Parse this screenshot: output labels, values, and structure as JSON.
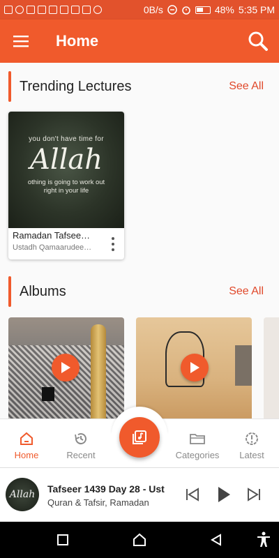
{
  "status_bar": {
    "network_speed": "0B/s",
    "battery": "48%",
    "time": "5:35 PM"
  },
  "app_bar": {
    "title": "Home"
  },
  "trending": {
    "title": "Trending Lectures",
    "see_all": "See All",
    "card": {
      "thumb_line1": "you don't have time for",
      "thumb_big": "Allah",
      "thumb_line2": "othing is going to work out",
      "thumb_line3": "right in your life",
      "title": "Ramadan Tafsee…",
      "speaker": "Ustadh Qamaarudee…"
    }
  },
  "albums": {
    "title": "Albums",
    "see_all": "See All"
  },
  "bottom_nav": {
    "items": [
      {
        "label": "Home",
        "icon": "home-icon",
        "active": true
      },
      {
        "label": "Recent",
        "icon": "history-icon",
        "active": false
      },
      {
        "label": "Categories",
        "icon": "folder-icon",
        "active": false
      },
      {
        "label": "Latest",
        "icon": "alert-icon",
        "active": false
      }
    ],
    "fab_icon": "music-library-icon"
  },
  "player": {
    "art_text": "Allah",
    "title": "Tafseer 1439 Day 28 - Ust",
    "subtitle": "Quran & Tafsir, Ramadan"
  },
  "colors": {
    "primary": "#f05a2c",
    "status_bar": "#e2522c"
  }
}
